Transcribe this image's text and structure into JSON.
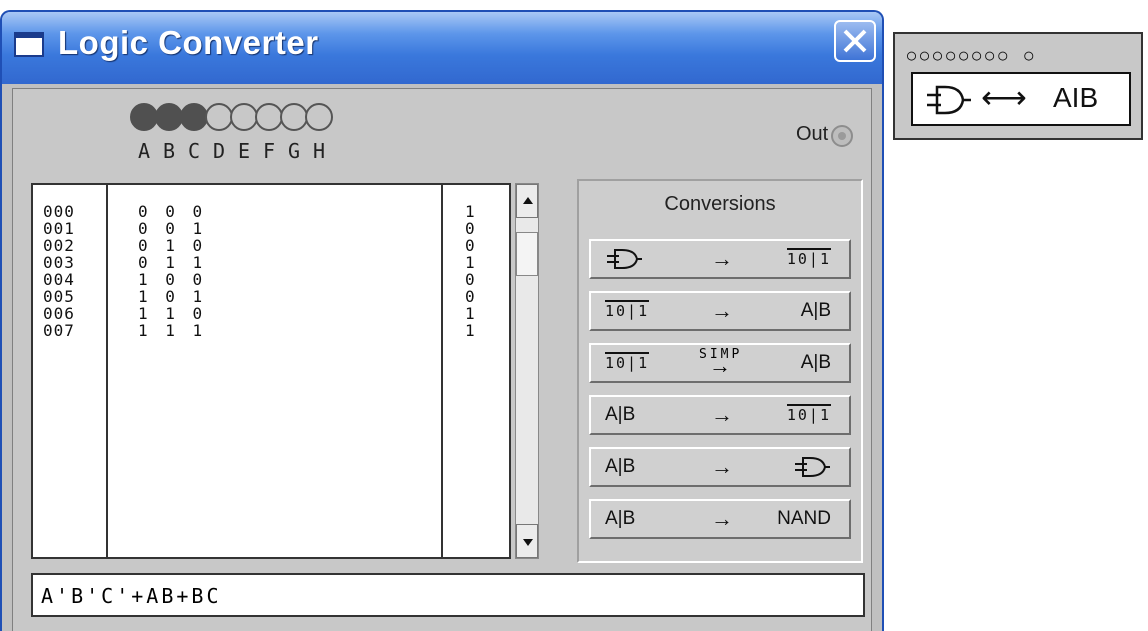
{
  "window": {
    "title": "Logic Converter"
  },
  "inputs": [
    {
      "label": "A",
      "active": true
    },
    {
      "label": "B",
      "active": true
    },
    {
      "label": "C",
      "active": true
    },
    {
      "label": "D",
      "active": false
    },
    {
      "label": "E",
      "active": false
    },
    {
      "label": "F",
      "active": false
    },
    {
      "label": "G",
      "active": false
    },
    {
      "label": "H",
      "active": false
    }
  ],
  "output": {
    "label": "Out"
  },
  "truth_table": [
    {
      "index": "000",
      "bits": "0 0 0",
      "out": "1"
    },
    {
      "index": "001",
      "bits": "0 0 1",
      "out": "0"
    },
    {
      "index": "002",
      "bits": "0 1 0",
      "out": "0"
    },
    {
      "index": "003",
      "bits": "0 1 1",
      "out": "1"
    },
    {
      "index": "004",
      "bits": "1 0 0",
      "out": "0"
    },
    {
      "index": "005",
      "bits": "1 0 1",
      "out": "0"
    },
    {
      "index": "006",
      "bits": "1 1 0",
      "out": "1"
    },
    {
      "index": "007",
      "bits": "1 1 1",
      "out": "1"
    }
  ],
  "conversions": {
    "title": "Conversions",
    "buttons": [
      {
        "left": "gate-icon",
        "right": "10|1"
      },
      {
        "left": "10|1",
        "right": "A|B"
      },
      {
        "left": "10|1",
        "middle": "SIMP",
        "right": "A|B"
      },
      {
        "left": "A|B",
        "right": "10|1"
      },
      {
        "left": "A|B",
        "right": "gate-icon"
      },
      {
        "left": "A|B",
        "right": "NAND"
      }
    ],
    "arrow": "→"
  },
  "expression": {
    "value": "A'B'C'+AB+BC"
  },
  "component": {
    "pins": "○○○○○○○○ ○",
    "arrow": "⟷",
    "label": "AIB"
  }
}
